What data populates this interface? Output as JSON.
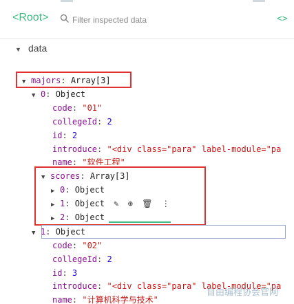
{
  "header": {
    "breadcrumb": "<Root>",
    "filter_placeholder": "Filter inspected data",
    "code_icon": "<>"
  },
  "section": {
    "title": "data"
  },
  "tree": {
    "majors_key": "majors",
    "majors_type": "Array[3]",
    "item0": {
      "label": "0",
      "type": "Object",
      "code_key": "code",
      "code_val": "\"01\"",
      "college_key": "collegeId",
      "college_val": "2",
      "id_key": "id",
      "id_val": "2",
      "intro_key": "introduce",
      "intro_val": "\"<div class=\"para\" label-module=\"pa",
      "name_key": "name",
      "name_val": "\"软件工程\"",
      "scores_key": "scores",
      "scores_type": "Array[3]",
      "scores": [
        {
          "label": "0",
          "type": "Object"
        },
        {
          "label": "1",
          "type": "Object"
        },
        {
          "label": "2",
          "type": "Object"
        }
      ]
    },
    "item1": {
      "label": "1",
      "type": "Object",
      "code_key": "code",
      "code_val": "\"02\"",
      "college_key": "collegeId",
      "college_val": "2",
      "id_key": "id",
      "id_val": "3",
      "intro_key": "introduce",
      "intro_val": "\"<div class=\"para\" label-module=\"pa",
      "name_key": "name",
      "name_val": "\"计算机科学与技术\""
    }
  },
  "actions": {
    "edit_icon": "✎",
    "add_icon": "⊕",
    "delete_icon": "🗑",
    "more_icon": "⋮"
  },
  "watermark": "自由编程协会官网"
}
